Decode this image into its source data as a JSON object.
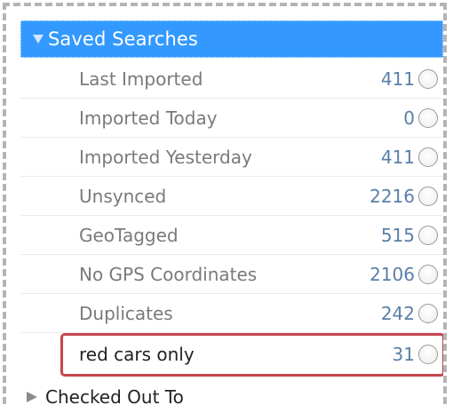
{
  "saved_searches": {
    "title": "Saved Searches",
    "expanded": true,
    "items": [
      {
        "label": "Last Imported",
        "count": "411"
      },
      {
        "label": "Imported Today",
        "count": "0"
      },
      {
        "label": "Imported Yesterday",
        "count": "411"
      },
      {
        "label": "Unsynced",
        "count": "2216"
      },
      {
        "label": "GeoTagged",
        "count": "515"
      },
      {
        "label": "No GPS Coordinates",
        "count": "2106"
      },
      {
        "label": "Duplicates",
        "count": "242"
      },
      {
        "label": "red cars only",
        "count": "31",
        "highlighted": true
      }
    ]
  },
  "checked_out_to": {
    "title": "Checked Out To",
    "expanded": false
  },
  "colors": {
    "header_bg": "#3399ff",
    "highlight_border": "#c4474d",
    "count_text": "#5a7fa8",
    "label_text": "#7a7a7a"
  },
  "icons": {
    "expanded": "triangle-down-icon",
    "collapsed": "triangle-right-icon",
    "item_selector": "radio-circle-icon"
  }
}
